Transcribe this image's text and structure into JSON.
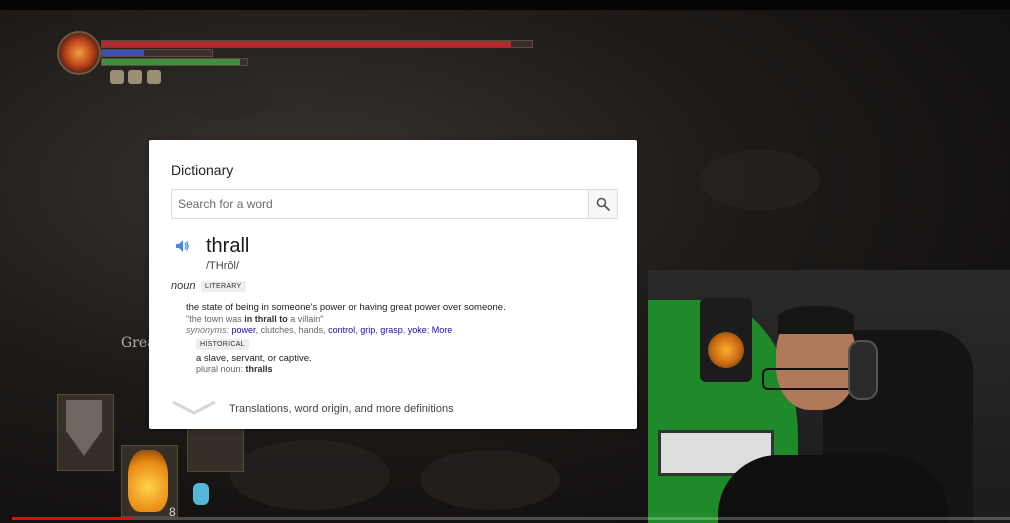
{
  "dictionary": {
    "title": "Dictionary",
    "search_placeholder": "Search for a word",
    "word": "thrall",
    "phonetic": "/THrôl/",
    "part_of_speech": "noun",
    "register_tag": "LITERARY",
    "definition": "the state of being in someone's power or having great power over someone.",
    "example": {
      "prefix": "\"the town was ",
      "bold": "in thrall to",
      "suffix": " a villain\""
    },
    "synonyms": {
      "label": "synonyms:",
      "items": [
        "power",
        "clutches",
        "hands",
        "control",
        "grip",
        "grasp",
        "yoke"
      ],
      "linked": [
        true,
        false,
        false,
        true,
        true,
        true,
        true
      ],
      "more_label": "More"
    },
    "historical_tag": "HISTORICAL",
    "sub_definition": "a slave, servant, or captive.",
    "plural": {
      "label": "plural noun: ",
      "value": "thralls"
    },
    "more_definitions": "Translations, word origin, and more definitions"
  },
  "game_hud": {
    "side_label": "Great",
    "estus_count": "8",
    "hp_ratio": 0.95,
    "fp_ratio": 0.38,
    "stamina_ratio": 0.95
  },
  "video": {
    "progress": 0.12,
    "progress_color": "#ff0000"
  },
  "colors": {
    "link": "#1a0dab",
    "speaker_icon": "#4285f4"
  }
}
